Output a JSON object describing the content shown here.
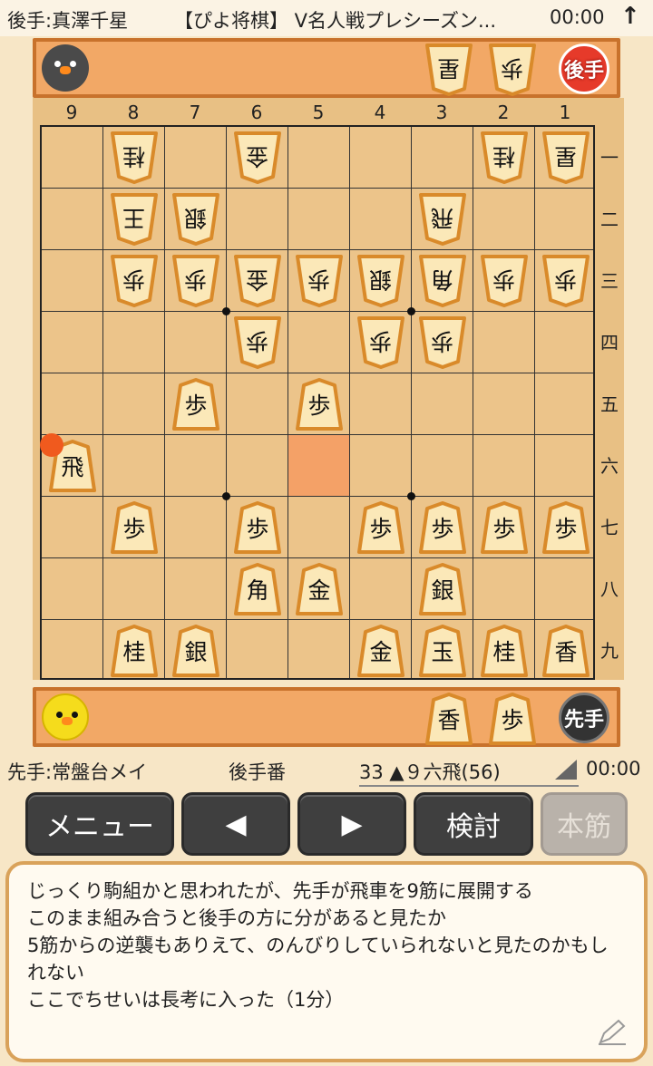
{
  "header": {
    "gote_player": "後手:真澤千星",
    "title": "【ぴよ将棋】 V名人戦プレシーズン...",
    "gote_clock": "00:00",
    "arrow_icon": "up-arrow-icon"
  },
  "gote_hand": {
    "badge": "後手",
    "pieces": [
      "星",
      "歩"
    ]
  },
  "sente_hand": {
    "badge": "先手",
    "pieces": [
      "香",
      "歩"
    ]
  },
  "board": {
    "files": [
      "9",
      "8",
      "7",
      "6",
      "5",
      "4",
      "3",
      "2",
      "1"
    ],
    "ranks": [
      "一",
      "二",
      "三",
      "四",
      "五",
      "六",
      "七",
      "八",
      "九"
    ],
    "pieces": [
      {
        "file": 8,
        "rank": 1,
        "kanji": "桂",
        "owner": "gote"
      },
      {
        "file": 6,
        "rank": 1,
        "kanji": "金",
        "owner": "gote"
      },
      {
        "file": 2,
        "rank": 1,
        "kanji": "桂",
        "owner": "gote"
      },
      {
        "file": 1,
        "rank": 1,
        "kanji": "星",
        "owner": "gote"
      },
      {
        "file": 8,
        "rank": 2,
        "kanji": "王",
        "owner": "gote"
      },
      {
        "file": 7,
        "rank": 2,
        "kanji": "銀",
        "owner": "gote"
      },
      {
        "file": 3,
        "rank": 2,
        "kanji": "飛",
        "owner": "gote"
      },
      {
        "file": 8,
        "rank": 3,
        "kanji": "歩",
        "owner": "gote"
      },
      {
        "file": 7,
        "rank": 3,
        "kanji": "歩",
        "owner": "gote"
      },
      {
        "file": 6,
        "rank": 3,
        "kanji": "金",
        "owner": "gote"
      },
      {
        "file": 5,
        "rank": 3,
        "kanji": "歩",
        "owner": "gote"
      },
      {
        "file": 4,
        "rank": 3,
        "kanji": "銀",
        "owner": "gote"
      },
      {
        "file": 3,
        "rank": 3,
        "kanji": "角",
        "owner": "gote"
      },
      {
        "file": 2,
        "rank": 3,
        "kanji": "歩",
        "owner": "gote"
      },
      {
        "file": 1,
        "rank": 3,
        "kanji": "歩",
        "owner": "gote"
      },
      {
        "file": 6,
        "rank": 4,
        "kanji": "歩",
        "owner": "gote"
      },
      {
        "file": 4,
        "rank": 4,
        "kanji": "歩",
        "owner": "gote"
      },
      {
        "file": 3,
        "rank": 4,
        "kanji": "歩",
        "owner": "gote"
      },
      {
        "file": 7,
        "rank": 5,
        "kanji": "歩",
        "owner": "sente"
      },
      {
        "file": 5,
        "rank": 5,
        "kanji": "歩",
        "owner": "sente"
      },
      {
        "file": 9,
        "rank": 6,
        "kanji": "飛",
        "owner": "sente"
      },
      {
        "file": 8,
        "rank": 7,
        "kanji": "歩",
        "owner": "sente"
      },
      {
        "file": 6,
        "rank": 7,
        "kanji": "歩",
        "owner": "sente"
      },
      {
        "file": 4,
        "rank": 7,
        "kanji": "歩",
        "owner": "sente"
      },
      {
        "file": 3,
        "rank": 7,
        "kanji": "歩",
        "owner": "sente"
      },
      {
        "file": 2,
        "rank": 7,
        "kanji": "歩",
        "owner": "sente"
      },
      {
        "file": 1,
        "rank": 7,
        "kanji": "歩",
        "owner": "sente"
      },
      {
        "file": 6,
        "rank": 8,
        "kanji": "角",
        "owner": "sente"
      },
      {
        "file": 5,
        "rank": 8,
        "kanji": "金",
        "owner": "sente"
      },
      {
        "file": 3,
        "rank": 8,
        "kanji": "銀",
        "owner": "sente"
      },
      {
        "file": 8,
        "rank": 9,
        "kanji": "桂",
        "owner": "sente"
      },
      {
        "file": 7,
        "rank": 9,
        "kanji": "銀",
        "owner": "sente"
      },
      {
        "file": 4,
        "rank": 9,
        "kanji": "金",
        "owner": "sente"
      },
      {
        "file": 3,
        "rank": 9,
        "kanji": "玉",
        "owner": "sente"
      },
      {
        "file": 2,
        "rank": 9,
        "kanji": "桂",
        "owner": "sente"
      },
      {
        "file": 1,
        "rank": 9,
        "kanji": "香",
        "owner": "sente"
      }
    ],
    "last_move_from": {
      "file": 5,
      "rank": 6
    },
    "last_move_to": {
      "file": 9,
      "rank": 6
    }
  },
  "status": {
    "sente_player": "先手:常盤台メイ",
    "side": "後手番",
    "move": "33 ▲９六飛(56)",
    "sente_clock": "00:00"
  },
  "buttons": {
    "menu": "メニュー",
    "prev": "◀",
    "next": "▶",
    "analyze": "検討",
    "main_line": "本筋"
  },
  "comment": "じっくり駒組かと思われたが、先手が飛車を9筋に展開する\nこのまま組み合うと後手の方に分があると見たか\n5筋からの逆襲もありえて、のんびりしていられないと見たのかもしれない\nここでちせいは長考に入った（1分）",
  "colors": {
    "hand_bar": "#f2a866",
    "board": "#ecc48a",
    "highlight": "#f5824a",
    "button": "#3f3f3f"
  }
}
